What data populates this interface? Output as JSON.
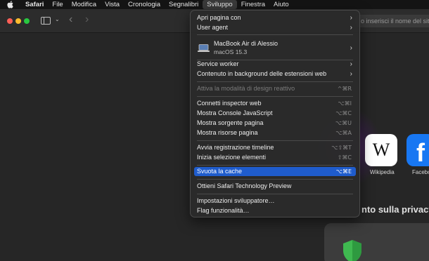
{
  "menubar": {
    "items": [
      "Safari",
      "File",
      "Modifica",
      "Vista",
      "Cronologia",
      "Segnalibri",
      "Sviluppo",
      "Finestra",
      "Aiuto"
    ]
  },
  "toolbar": {
    "address_placeholder": "o inserisci il nome del sito"
  },
  "favorites": {
    "items": [
      {
        "label": "Wikipedia",
        "glyph": "W"
      },
      {
        "label": "Facebook",
        "glyph": "f"
      }
    ]
  },
  "privacy": {
    "title": "nto sulla privacy"
  },
  "develop_menu": {
    "open_page_with": "Apri pagina con",
    "user_agent": "User agent",
    "device_name": "MacBook Air di Alessio",
    "device_os": "macOS 15.3",
    "service_worker": "Service worker",
    "extension_content": "Contenuto in background delle estensioni web",
    "design_mode": "Attiva la modalità di design reattivo",
    "design_mode_shortcut": "^⌘R",
    "inspector": "Connetti inspector web",
    "inspector_shortcut": "⌥⌘I",
    "console": "Mostra Console JavaScript",
    "console_shortcut": "⌥⌘C",
    "source": "Mostra sorgente pagina",
    "source_shortcut": "⌥⌘U",
    "resources": "Mostra risorse pagina",
    "resources_shortcut": "⌥⌘A",
    "timeline": "Avvia registrazione timeline",
    "timeline_shortcut": "⌥⇧⌘T",
    "select_element": "Inizia selezione elementi",
    "select_element_shortcut": "⇧⌘C",
    "empty_cache": "Svuota la cache",
    "empty_cache_shortcut": "⌥⌘E",
    "tech_preview": "Ottieni Safari Technology Preview",
    "dev_settings": "Impostazioni sviluppatore…",
    "feature_flags": "Flag funzionalità…"
  },
  "colors": {
    "accent": "#1f5ccc",
    "facebook": "#1877f2",
    "shield": "#3fb950"
  }
}
